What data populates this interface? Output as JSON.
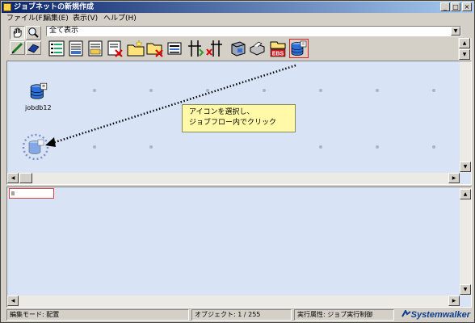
{
  "window": {
    "title": "ジョブネットの新規作成",
    "controls": {
      "minimize": "_",
      "maximize": "□",
      "close": "×"
    }
  },
  "menu": [
    {
      "label": "ファイル(F)"
    },
    {
      "label": "編集(E)"
    },
    {
      "label": "表示(V)"
    },
    {
      "label": "ヘルプ(H)"
    }
  ],
  "toolbar": {
    "tools": [
      {
        "name": "hand-tool",
        "icon": "hand-icon"
      },
      {
        "name": "zoom-tool",
        "icon": "magnifier-icon"
      },
      {
        "name": "pen-tool",
        "icon": "pen-icon"
      },
      {
        "name": "eraser-tool",
        "icon": "eraser-icon"
      }
    ],
    "filter": {
      "value": "全て表示"
    },
    "palette": [
      "job-list-icon",
      "job-document-icon",
      "job-document-gear-icon",
      "job-document-delete-icon",
      "folder-new-icon",
      "folder-delete-icon",
      "job-print-icon",
      "branch-icon",
      "branch-stop-icon",
      "server-icon",
      "printer-icon",
      "ebs-icon",
      "database-job-icon"
    ]
  },
  "canvas": {
    "job_label": "jobdb12",
    "tooltip": {
      "line1": "アイコンを選択し、",
      "line2": "ジョブフロー内でクリック"
    }
  },
  "status": {
    "mode": "編集モード: 配置",
    "objects": "オブジェクト: 1 / 255",
    "attribute": "実行属性: ジョブ実行制御",
    "brand": "Systemwalker"
  },
  "colors": {
    "canvas_bg": "#d9e3f6",
    "selection": "#e02020",
    "tooltip_bg": "#fff9a8",
    "brand": "#0b3d91"
  }
}
